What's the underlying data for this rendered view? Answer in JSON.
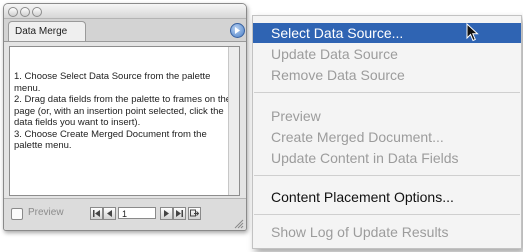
{
  "palette": {
    "tab_label": "Data Merge",
    "instructions": [
      "1. Choose Select Data Source from the palette menu.",
      "2. Drag data fields from the palette to frames on the page (or, with an insertion point selected, click the data fields you want to insert).",
      "3. Choose Create Merged Document from the palette menu."
    ],
    "preview_label": "Preview",
    "record_number": "1"
  },
  "menu": {
    "items": [
      {
        "label": "Select Data Source...",
        "state": "highlighted"
      },
      {
        "label": "Update Data Source",
        "state": "disabled"
      },
      {
        "label": "Remove Data Source",
        "state": "disabled"
      },
      {
        "label": "Preview",
        "state": "disabled"
      },
      {
        "label": "Create Merged Document...",
        "state": "disabled"
      },
      {
        "label": "Update Content in Data Fields",
        "state": "disabled"
      },
      {
        "label": "Content Placement Options...",
        "state": "enabled"
      },
      {
        "label": "Show Log of Update Results",
        "state": "disabled"
      }
    ]
  },
  "colors": {
    "highlight": "#2f64b3",
    "disabled_text": "#9c9c9c",
    "enabled_text": "#111111"
  },
  "icons": [
    "close-icon",
    "minimize-icon",
    "zoom-icon",
    "palette-menu-arrow-icon",
    "first-record-icon",
    "previous-record-icon",
    "next-record-icon",
    "last-record-icon",
    "resize-grip-icon",
    "mouse-pointer-icon"
  ]
}
